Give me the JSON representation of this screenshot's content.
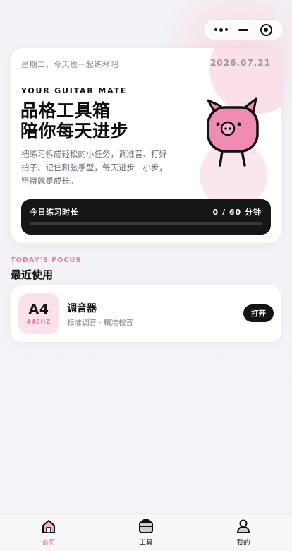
{
  "header": {
    "capsule": {
      "more": "more-icon",
      "minimize": "minus-icon",
      "close": "target-icon"
    }
  },
  "hero": {
    "greeting": "星期二，今天也一起练琴吧",
    "date": "2026.07.21",
    "eyebrow": "YOUR GUITAR MATE",
    "title_line1": "品格工具箱",
    "title_line2": "陪你每天进步",
    "desc": "把练习拆成轻松的小任务，调准音、打好拍子、记住和弦手型，每天进步一小步，坚持就是成长。",
    "mascot": "pig-mascot-icon",
    "practice": {
      "label": "今日练习时长",
      "value": "0 / 60 分钟",
      "progress": 0
    }
  },
  "focus": {
    "eyebrow": "TODAY'S FOCUS",
    "title": "最近使用",
    "tool": {
      "icon_big": "A4",
      "icon_small": "440HZ",
      "name": "调音器",
      "sub": "标准调音 · 精准校音",
      "action": "打开"
    }
  },
  "tabbar": {
    "items": [
      {
        "label": "首页",
        "icon": "home-icon",
        "active": true
      },
      {
        "label": "工具",
        "icon": "toolbox-icon",
        "active": false
      },
      {
        "label": "我的",
        "icon": "profile-icon",
        "active": false
      }
    ]
  },
  "colors": {
    "accent": "#e87aa4",
    "dark": "#161616",
    "card": "#ffffff"
  }
}
